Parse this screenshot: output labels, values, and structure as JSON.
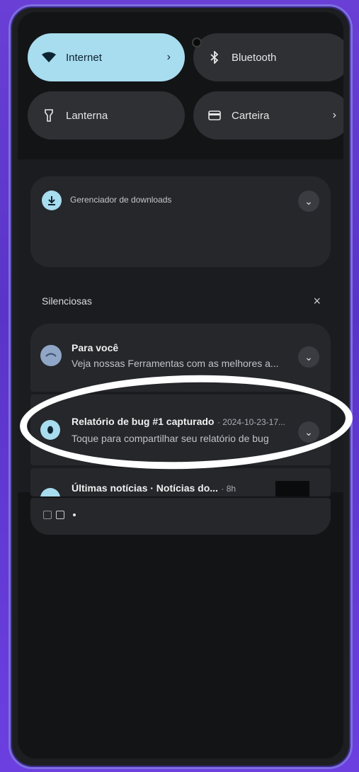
{
  "quick_settings": {
    "internet": {
      "label": "Internet",
      "icon": "wifi-icon"
    },
    "bluetooth": {
      "label": "Bluetooth",
      "icon": "bluetooth-icon"
    },
    "flashlight": {
      "label": "Lanterna",
      "icon": "flashlight-icon"
    },
    "wallet": {
      "label": "Carteira",
      "icon": "wallet-icon"
    }
  },
  "download_notification": {
    "app_name": "Gerenciador de downloads",
    "icon": "download-icon"
  },
  "silent_section": {
    "title": "Silenciosas",
    "clear_label": "×"
  },
  "notifications": [
    {
      "title": "Para você",
      "text": "Veja nossas Ferramentas com as melhores a..."
    },
    {
      "title": "Relatório de bug #1 capturado",
      "meta": "· 2024-10-23-17...",
      "text": "Toque para compartilhar seu relatório de bug"
    },
    {
      "title": "Últimas notícias · Notícias do...",
      "meta": "· 8h"
    }
  ],
  "colors": {
    "accent_tile": "#a8dcef",
    "background": "#6a3fd6",
    "annotation": "#ffffff"
  }
}
